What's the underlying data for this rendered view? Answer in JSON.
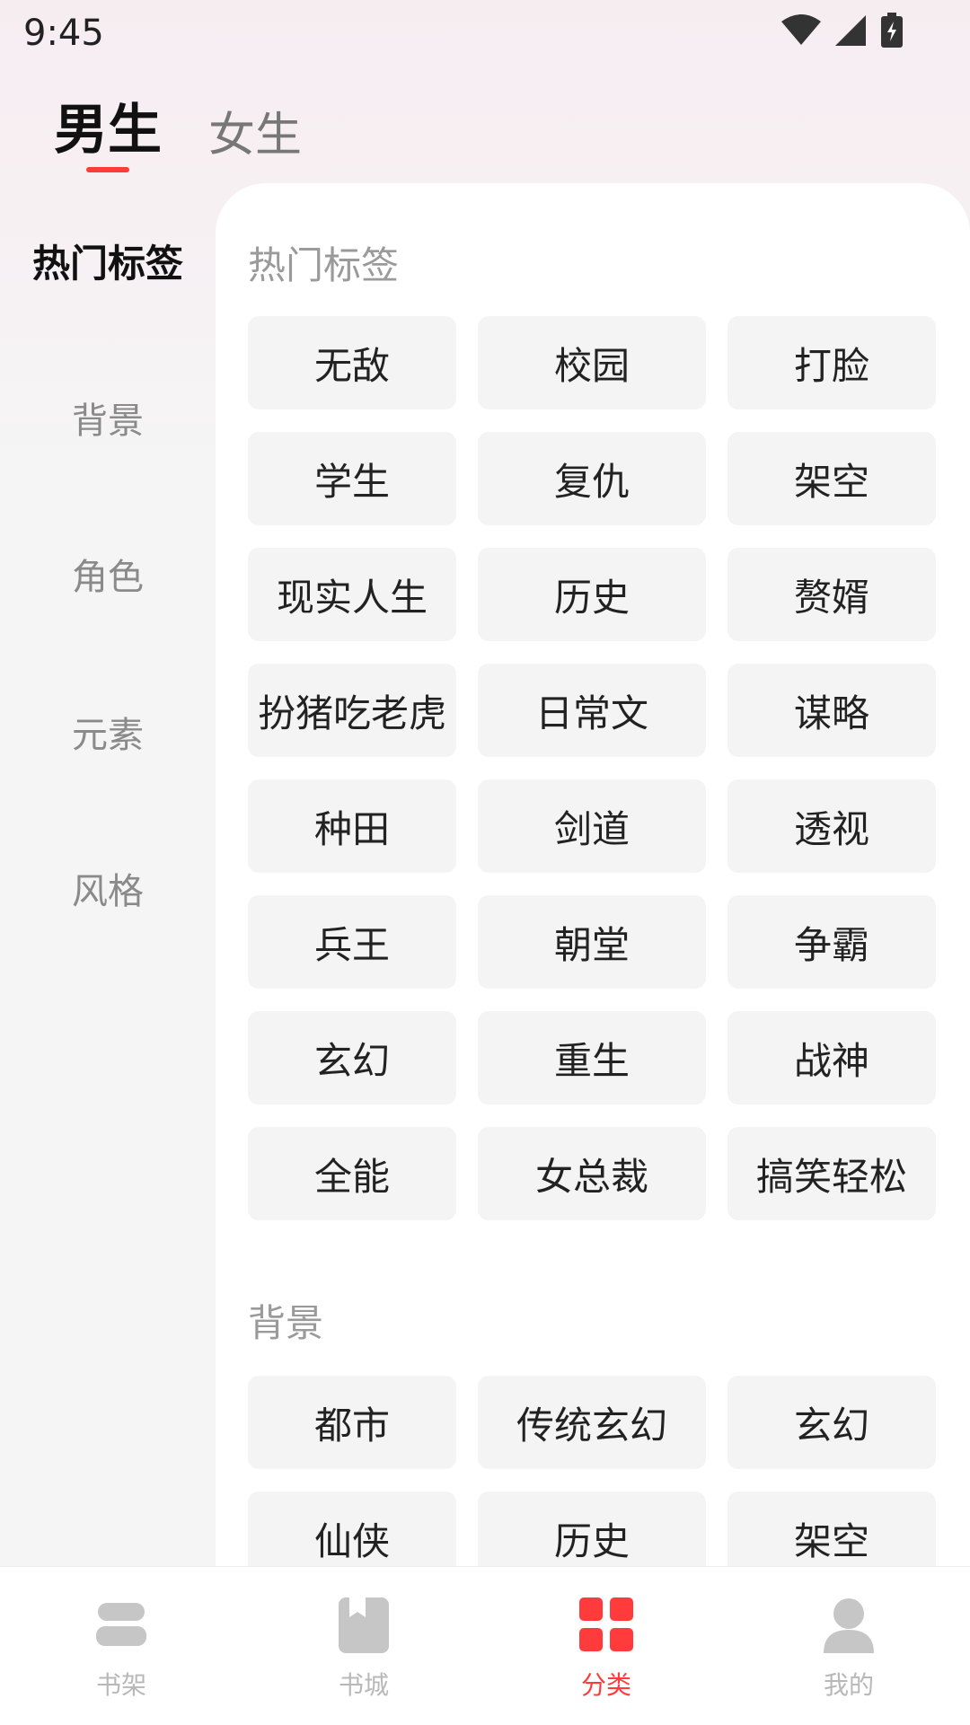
{
  "status": {
    "time": "9:45"
  },
  "gender_tabs": [
    {
      "label": "男生",
      "active": true
    },
    {
      "label": "女生",
      "active": false
    }
  ],
  "sidebar": {
    "items": [
      {
        "label": "热门标签",
        "active": true
      },
      {
        "label": "背景",
        "active": false
      },
      {
        "label": "角色",
        "active": false
      },
      {
        "label": "元素",
        "active": false
      },
      {
        "label": "风格",
        "active": false
      }
    ]
  },
  "sections": [
    {
      "title": "热门标签",
      "tags": [
        "无敌",
        "校园",
        "打脸",
        "学生",
        "复仇",
        "架空",
        "现实人生",
        "历史",
        "赘婿",
        "扮猪吃老虎",
        "日常文",
        "谋略",
        "种田",
        "剑道",
        "透视",
        "兵王",
        "朝堂",
        "争霸",
        "玄幻",
        "重生",
        "战神",
        "全能",
        "女总裁",
        "搞笑轻松"
      ]
    },
    {
      "title": "背景",
      "tags": [
        "都市",
        "传统玄幻",
        "玄幻",
        "仙侠",
        "历史",
        "架空"
      ]
    }
  ],
  "bottom_nav": [
    {
      "label": "书架",
      "icon": "bookshelf-icon",
      "active": false
    },
    {
      "label": "书城",
      "icon": "bookstore-icon",
      "active": false
    },
    {
      "label": "分类",
      "icon": "category-grid-icon",
      "active": true
    },
    {
      "label": "我的",
      "icon": "profile-icon",
      "active": false
    }
  ],
  "colors": {
    "accent": "#ff3b3b",
    "tag_bg": "#f4f4f4",
    "nav_inactive": "#c6c6c6"
  }
}
